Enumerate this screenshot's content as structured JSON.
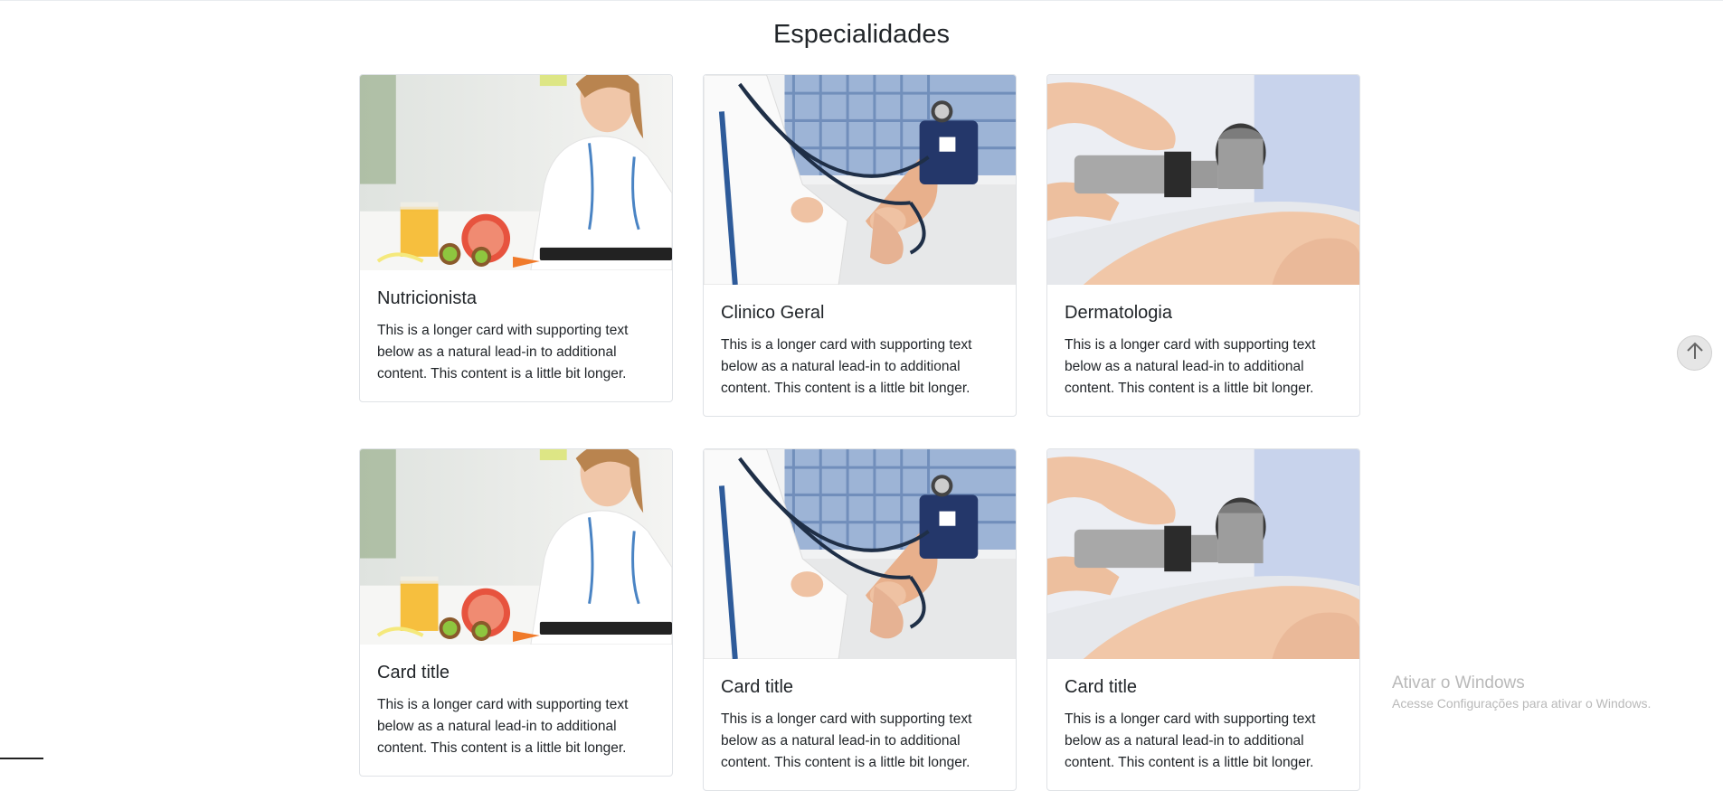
{
  "section": {
    "title": "Especialidades"
  },
  "cards": [
    {
      "title": "Nutricionista",
      "text": "This is a longer card with supporting text below as a natural lead-in to additional content. This content is a little bit longer.",
      "image": "nutritionist-photo"
    },
    {
      "title": "Clinico Geral",
      "text": "This is a longer card with supporting text below as a natural lead-in to additional content. This content is a little bit longer.",
      "image": "blood-pressure-photo"
    },
    {
      "title": "Dermatologia",
      "text": "This is a longer card with supporting text below as a natural lead-in to additional content. This content is a little bit longer.",
      "image": "dermatoscope-photo"
    },
    {
      "title": "Card title",
      "text": "This is a longer card with supporting text below as a natural lead-in to additional content. This content is a little bit longer.",
      "image": "nutritionist-photo"
    },
    {
      "title": "Card title",
      "text": "This is a longer card with supporting text below as a natural lead-in to additional content. This content is a little bit longer.",
      "image": "blood-pressure-photo"
    },
    {
      "title": "Card title",
      "text": "This is a longer card with supporting text below as a natural lead-in to additional content. This content is a little bit longer.",
      "image": "dermatoscope-photo"
    }
  ],
  "scroll_top": {
    "icon": "arrow-up-icon"
  },
  "watermark": {
    "title": "Ativar o Windows",
    "subtitle": "Acesse Configurações para ativar o Windows."
  }
}
